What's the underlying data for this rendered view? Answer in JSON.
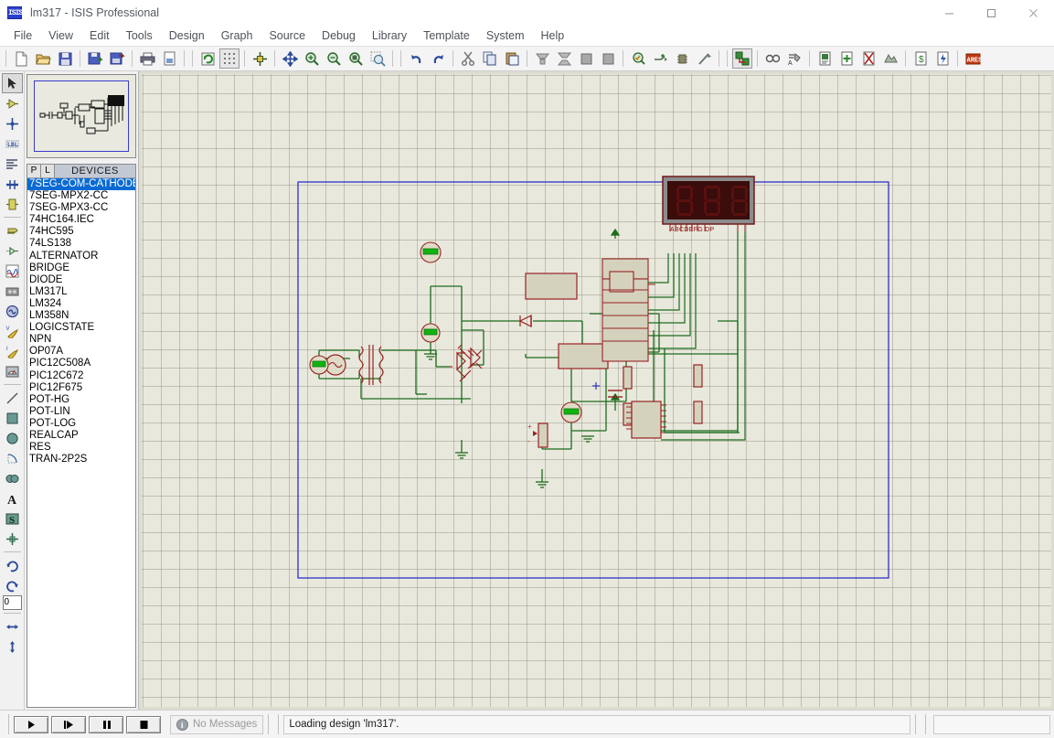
{
  "window": {
    "title": "lm317 - ISIS Professional",
    "app_icon": "isis-logo-icon",
    "minimize": "–",
    "maximize": "□",
    "close": "×"
  },
  "menubar": {
    "items": [
      {
        "label": "File",
        "name": "menu-file"
      },
      {
        "label": "View",
        "name": "menu-view"
      },
      {
        "label": "Edit",
        "name": "menu-edit"
      },
      {
        "label": "Tools",
        "name": "menu-tools"
      },
      {
        "label": "Design",
        "name": "menu-design"
      },
      {
        "label": "Graph",
        "name": "menu-graph"
      },
      {
        "label": "Source",
        "name": "menu-source"
      },
      {
        "label": "Debug",
        "name": "menu-debug"
      },
      {
        "label": "Library",
        "name": "menu-library"
      },
      {
        "label": "Template",
        "name": "menu-template"
      },
      {
        "label": "System",
        "name": "menu-system"
      },
      {
        "label": "Help",
        "name": "menu-help"
      }
    ]
  },
  "toolbar": {
    "groups": [
      [
        "new-file-icon",
        "open-folder-icon",
        "save-icon"
      ],
      [
        "import-section-icon",
        "export-section-icon"
      ],
      [
        "print-icon",
        "print-area-icon"
      ],
      [
        "redraw-icon",
        "toggle-grid-icon",
        "origin-icon"
      ],
      [
        "pan-icon",
        "zoom-in-icon",
        "zoom-out-icon",
        "zoom-sheet-icon",
        "zoom-area-icon"
      ],
      [
        "undo-icon",
        "redo-icon"
      ],
      [
        "cut-icon",
        "copy-icon",
        "paste-icon"
      ],
      [
        "block-copy-icon",
        "block-move-icon",
        "block-rotate-icon",
        "block-delete-icon"
      ],
      [
        "pick-device-icon",
        "make-device-icon",
        "packaging-tool-icon",
        "decompose-icon"
      ],
      [
        "wire-autorouter-icon"
      ],
      [
        "search-tag-icon",
        "property-assignment-icon"
      ],
      [
        "design-explorer-icon",
        "new-sheet-icon",
        "remove-sheet-icon",
        "exit-sheet-icon"
      ],
      [
        "bill-of-materials-icon",
        "electrical-rule-check-icon"
      ],
      [
        "netlist-to-ares-icon"
      ]
    ]
  },
  "modebar": {
    "items": [
      {
        "name": "selection-mode-icon",
        "selected": true
      },
      {
        "name": "component-mode-icon",
        "selected": false
      },
      {
        "name": "junction-dot-mode-icon",
        "selected": false
      },
      {
        "name": "wire-label-mode-icon",
        "selected": false
      },
      {
        "name": "text-script-mode-icon",
        "selected": false
      },
      {
        "name": "bus-mode-icon",
        "selected": false
      },
      {
        "name": "subcircuit-mode-icon",
        "selected": false
      },
      {
        "name": "terminals-mode-icon",
        "selected": false
      },
      {
        "name": "device-pin-mode-icon",
        "selected": false
      },
      {
        "name": "graph-mode-icon",
        "selected": false
      },
      {
        "name": "tape-recorder-mode-icon",
        "selected": false
      },
      {
        "name": "generator-mode-icon",
        "selected": false
      },
      {
        "name": "voltage-probe-mode-icon",
        "selected": false
      },
      {
        "name": "current-probe-mode-icon",
        "selected": false
      },
      {
        "name": "virtual-instrument-mode-icon",
        "selected": false
      },
      {
        "name": "line-tool-icon",
        "selected": false
      },
      {
        "name": "box-tool-icon",
        "selected": false
      },
      {
        "name": "circle-tool-icon",
        "selected": false
      },
      {
        "name": "arc-tool-icon",
        "selected": false
      },
      {
        "name": "path-tool-icon",
        "selected": false
      },
      {
        "name": "text-tool-icon",
        "selected": false
      },
      {
        "name": "symbol-tool-icon",
        "selected": false
      },
      {
        "name": "marker-tool-icon",
        "selected": false
      }
    ],
    "rotate": {
      "clockwise": "rotate-clockwise-icon",
      "anticlockwise": "rotate-anticlockwise-icon",
      "angle_value": "0",
      "mirror_x": "mirror-horizontal-icon",
      "mirror_y": "mirror-vertical-icon"
    }
  },
  "sidebar": {
    "preview_label": "overview-preview",
    "devices_panel": {
      "tab_p": "P",
      "tab_l": "L",
      "title": "DEVICES",
      "selected_index": 0,
      "items": [
        "7SEG-COM-CATHODE",
        "7SEG-MPX2-CC",
        "7SEG-MPX3-CC",
        "74HC164.IEC",
        "74HC595",
        "74LS138",
        "ALTERNATOR",
        "BRIDGE",
        "DIODE",
        "LM317L",
        "LM324",
        "LM358N",
        "LOGICSTATE",
        "NPN",
        "OP07A",
        "PIC12C508A",
        "PIC12C672",
        "PIC12F675",
        "POT-HG",
        "POT-LIN",
        "POT-LOG",
        "REALCAP",
        "RES",
        "TRAN-2P2S"
      ]
    }
  },
  "statusbar": {
    "animate_play": "play-icon",
    "animate_step": "step-icon",
    "animate_pause": "pause-icon",
    "animate_stop": "stop-icon",
    "messages_icon": "info-icon",
    "messages_text": "No Messages",
    "status_text": "Loading design 'lm317'."
  },
  "colors": {
    "canvas_bg": "#e8e8dc",
    "grid": "#9a9a87",
    "sheet_border": "#2222cc",
    "wire": "#1c6b1c",
    "component_outline": "#992222",
    "component_fill": "#d4d2bd",
    "probe_green": "#00a000",
    "display_red": "#5a1010",
    "selection_blue": "#0a6ad4"
  },
  "schematic": {
    "sheet_border_name": "sheet-boundary",
    "seven_segment_display": {
      "name": "seven-segment-display",
      "digits": "888",
      "pin_labels": "ABCDEFG DP"
    }
  }
}
